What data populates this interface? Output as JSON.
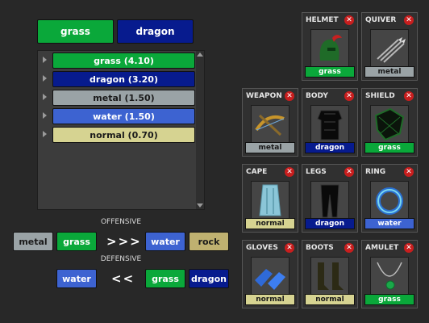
{
  "colors": {
    "grass": "#0aa83a",
    "dragon": "#071b8e",
    "metal": "#9aa3a6",
    "water": "#3d63d1",
    "normal": "#d6d391",
    "rock": "#bfb170"
  },
  "top_buttons": [
    {
      "label": "grass",
      "type": "grass"
    },
    {
      "label": "dragon",
      "type": "dragon"
    }
  ],
  "weakness_list": [
    {
      "label": "grass (4.10)",
      "type": "grass"
    },
    {
      "label": "dragon (3.20)",
      "type": "dragon"
    },
    {
      "label": "metal (1.50)",
      "type": "metal"
    },
    {
      "label": "water (1.50)",
      "type": "water"
    },
    {
      "label": "normal (0.70)",
      "type": "normal"
    }
  ],
  "offensive": {
    "heading": "OFFENSIVE",
    "left": [
      {
        "label": "metal",
        "type": "metal"
      },
      {
        "label": "grass",
        "type": "grass"
      }
    ],
    "operator": ">>>",
    "right": [
      {
        "label": "water",
        "type": "water"
      },
      {
        "label": "rock",
        "type": "rock"
      }
    ]
  },
  "defensive": {
    "heading": "DEFENSIVE",
    "left": [
      {
        "label": "water",
        "type": "water"
      }
    ],
    "operator": "<<",
    "right": [
      {
        "label": "grass",
        "type": "grass"
      },
      {
        "label": "dragon",
        "type": "dragon"
      }
    ]
  },
  "equipment": {
    "helmet": {
      "title": "HELMET",
      "tag": "grass",
      "type": "grass",
      "icon": "helmet-icon"
    },
    "quiver": {
      "title": "QUIVER",
      "tag": "metal",
      "type": "metal",
      "icon": "arrows-icon"
    },
    "weapon": {
      "title": "WEAPON",
      "tag": "metal",
      "type": "metal",
      "icon": "crossbow-icon"
    },
    "body": {
      "title": "BODY",
      "tag": "dragon",
      "type": "dragon",
      "icon": "body-armor-icon"
    },
    "shield": {
      "title": "SHIELD",
      "tag": "grass",
      "type": "grass",
      "icon": "shield-icon"
    },
    "cape": {
      "title": "CAPE",
      "tag": "normal",
      "type": "normal",
      "icon": "cape-icon"
    },
    "legs": {
      "title": "LEGS",
      "tag": "dragon",
      "type": "dragon",
      "icon": "legs-icon"
    },
    "ring": {
      "title": "RING",
      "tag": "water",
      "type": "water",
      "icon": "ring-icon"
    },
    "gloves": {
      "title": "GLOVES",
      "tag": "normal",
      "type": "normal",
      "icon": "gloves-icon"
    },
    "boots": {
      "title": "BOOTS",
      "tag": "normal",
      "type": "normal",
      "icon": "boots-icon"
    },
    "amulet": {
      "title": "AMULET",
      "tag": "grass",
      "type": "grass",
      "icon": "amulet-icon"
    }
  },
  "close_glyph": "✕"
}
